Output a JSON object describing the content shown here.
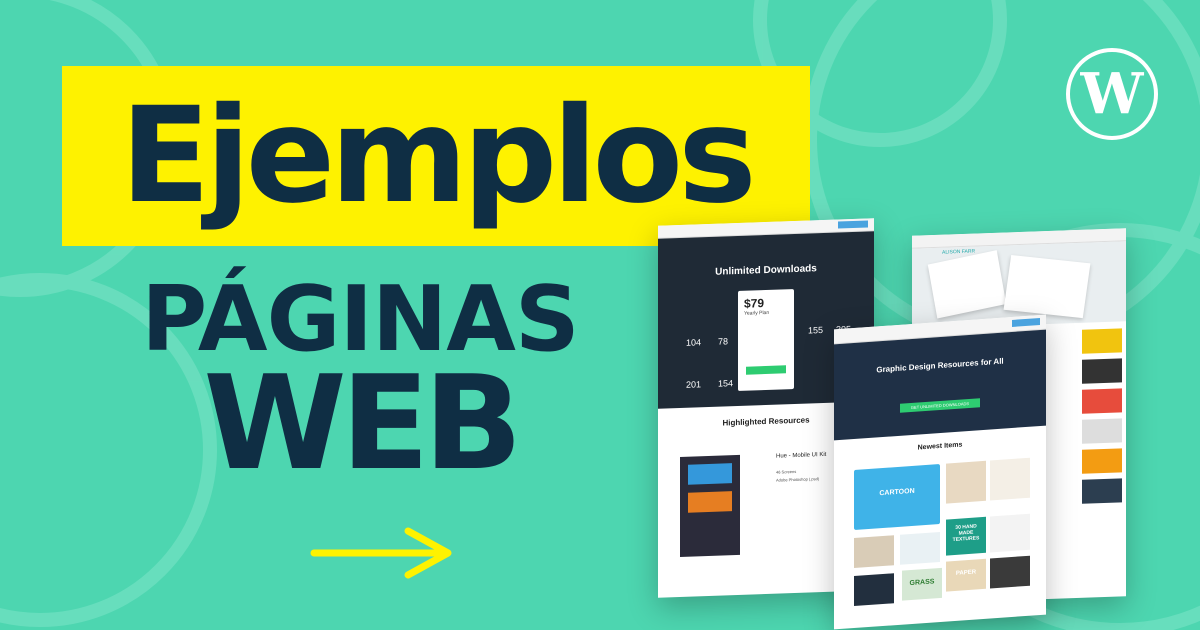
{
  "banner": {
    "title": "Ejemplos",
    "subtitle_line1": "PÁGINAS",
    "subtitle_line2": "WEB",
    "title_bg_color": "#fef200",
    "text_color": "#0f2e44",
    "background_color": "#4dd6b0",
    "arrow_color": "#fef200",
    "logo": "wordpress-logo",
    "logo_letter": "W"
  },
  "mockup_left": {
    "hero_title": "Unlimited Downloads",
    "price": "$79",
    "plan": "Yearly Plan",
    "stats": [
      "104",
      "78",
      "201",
      "154",
      "155",
      "305"
    ],
    "section_title": "Highlighted Resources",
    "resource_title": "Hue - Mobile UI Kit",
    "resource_meta1": "46 Screens",
    "resource_meta2": "Adobe Photoshop (.psd)"
  },
  "mockup_front": {
    "hero_title": "Graphic Design Resources for All",
    "cta": "GET UNLIMITED DOWNLOADS",
    "section_title": "Newest Items",
    "tile1": "CARTOON",
    "tile2": "30 HAND MADE TEXTURES",
    "tile3": "GRASS",
    "tile4": "PAPER"
  },
  "mockup_back": {
    "name": "ALISON FARR"
  }
}
